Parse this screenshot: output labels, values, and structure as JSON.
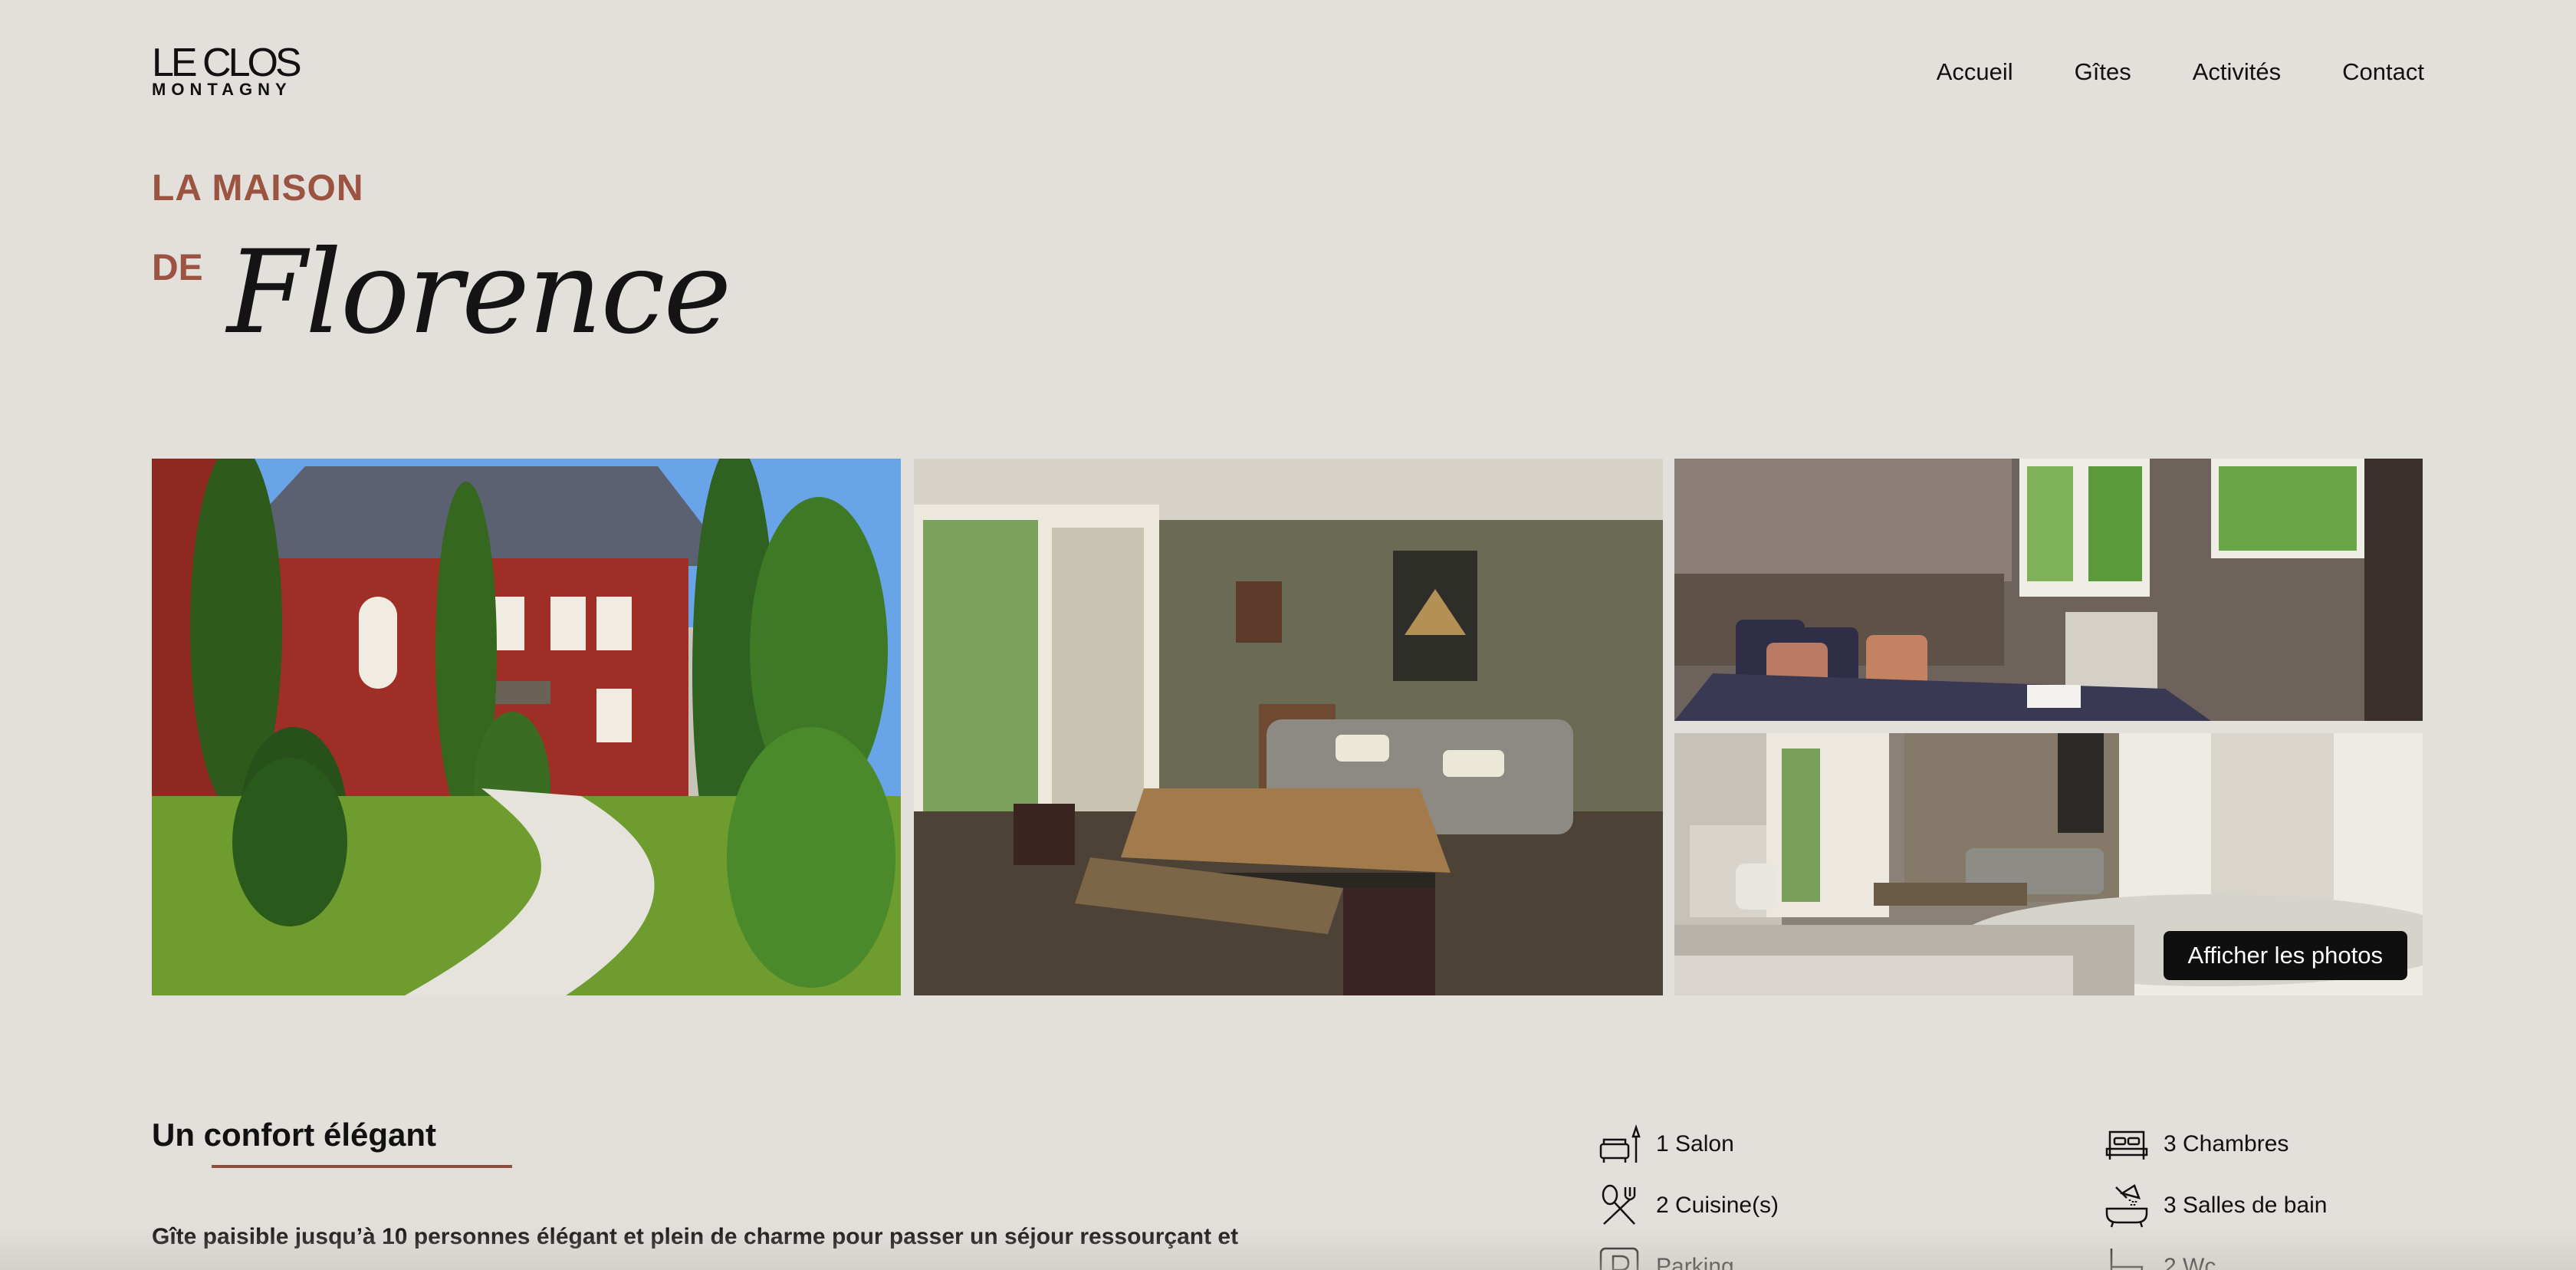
{
  "header": {
    "logo_top": "LE CLOS",
    "logo_bottom": "MONTAGNY",
    "nav": [
      "Accueil",
      "Gîtes",
      "Activités",
      "Contact"
    ]
  },
  "title": {
    "eyebrow": "LA MAISON",
    "prefix": "DE",
    "name": "Florence"
  },
  "gallery": {
    "photos": [
      "exterior-garden-photo",
      "living-room-photo",
      "bedroom-photo",
      "kitchen-dining-photo"
    ],
    "show_button": "Afficher les photos"
  },
  "content": {
    "heading": "Un confort élégant",
    "description": "Gîte paisible jusqu’à 10 personnes élégant et plein de charme pour passer un séjour ressourçant et"
  },
  "amenities": [
    {
      "icon": "living-room-icon",
      "label": "1 Salon"
    },
    {
      "icon": "kitchen-icon",
      "label": "2 Cuisine(s)"
    },
    {
      "icon": "parking-icon",
      "label": "Parking"
    },
    {
      "icon": "bed-icon",
      "label": "3 Chambres"
    },
    {
      "icon": "shower-icon",
      "label": "3 Salles de bain"
    },
    {
      "icon": "toilet-icon",
      "label": "2 Wc"
    }
  ],
  "colors": {
    "background": "#e3dfda",
    "accent": "#9a5441",
    "button": "#0f0f0f"
  }
}
